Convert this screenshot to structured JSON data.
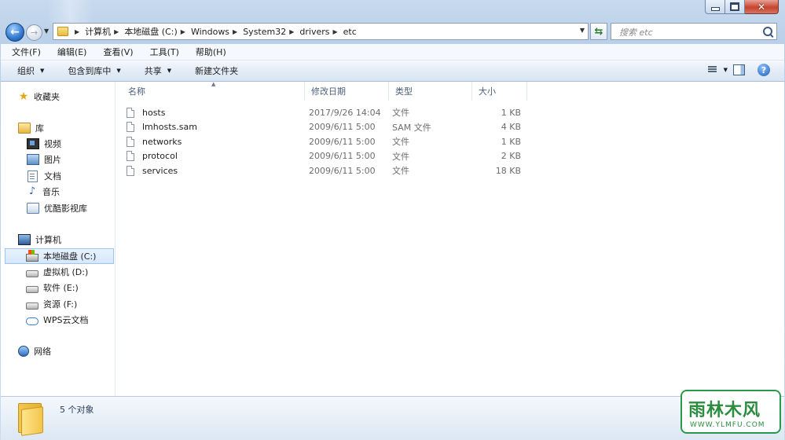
{
  "window": {
    "minimize_icon": "minimize-icon",
    "maximize_icon": "maximize-icon",
    "close_glyph": "✕"
  },
  "navigation": {
    "breadcrumbs": [
      "计算机",
      "本地磁盘 (C:)",
      "Windows",
      "System32",
      "drivers",
      "etc"
    ],
    "search_placeholder": "搜索 etc"
  },
  "menu": [
    "文件(F)",
    "编辑(E)",
    "查看(V)",
    "工具(T)",
    "帮助(H)"
  ],
  "commands": {
    "organize": "组织",
    "include_in_library": "包含到库中",
    "share": "共享",
    "new_folder": "新建文件夹"
  },
  "sidebar": {
    "favorites": "收藏夹",
    "libraries": "库",
    "library_items": [
      "视频",
      "图片",
      "文档",
      "音乐",
      "优酷影视库"
    ],
    "computer": "计算机",
    "drives": [
      {
        "label": "本地磁盘 (C:)",
        "icon": "system-drive-icon",
        "selected": true
      },
      {
        "label": "虚拟机 (D:)",
        "icon": "drive-icon",
        "selected": false
      },
      {
        "label": "软件 (E:)",
        "icon": "drive-icon",
        "selected": false
      },
      {
        "label": "资源 (F:)",
        "icon": "drive-icon",
        "selected": false
      },
      {
        "label": "WPS云文档",
        "icon": "cloud-icon",
        "selected": false
      }
    ],
    "network": "网络"
  },
  "columns": {
    "name": "名称",
    "modified": "修改日期",
    "type": "类型",
    "size": "大小"
  },
  "files": [
    {
      "name": "hosts",
      "modified": "2017/9/26 14:04",
      "type": "文件",
      "size": "1 KB"
    },
    {
      "name": "lmhosts.sam",
      "modified": "2009/6/11 5:00",
      "type": "SAM 文件",
      "size": "4 KB"
    },
    {
      "name": "networks",
      "modified": "2009/6/11 5:00",
      "type": "文件",
      "size": "1 KB"
    },
    {
      "name": "protocol",
      "modified": "2009/6/11 5:00",
      "type": "文件",
      "size": "2 KB"
    },
    {
      "name": "services",
      "modified": "2009/6/11 5:00",
      "type": "文件",
      "size": "18 KB"
    }
  ],
  "status": {
    "item_count": "5 个对象"
  },
  "watermark": {
    "logo": "雨林木风",
    "url": "WWW.YLMFU.COM"
  }
}
